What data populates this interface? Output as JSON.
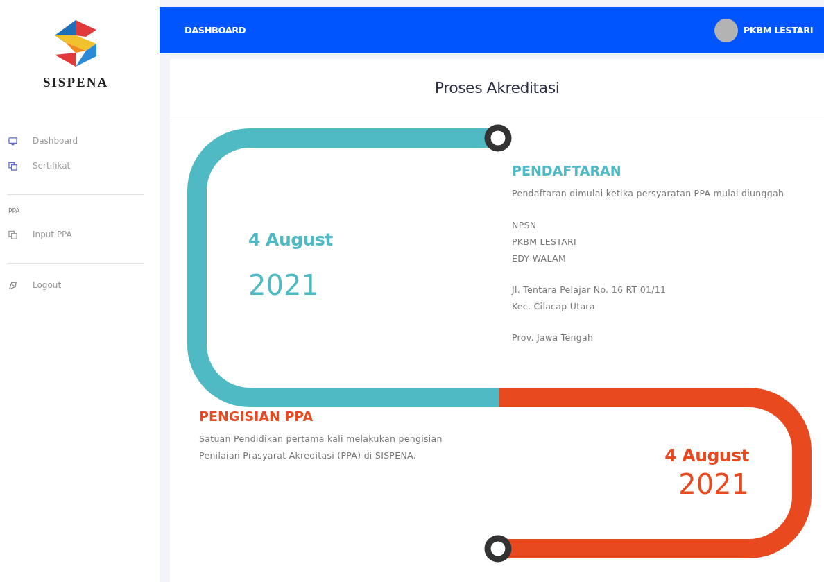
{
  "sidebar": {
    "logo_text": "SISPENA",
    "groups": [
      {
        "items": [
          {
            "label": "Dashboard",
            "kind": "monitor"
          },
          {
            "label": "Sertifikat",
            "kind": "copy"
          }
        ]
      },
      {
        "heading": "PPA",
        "items": [
          {
            "label": "Input PPA",
            "kind": "copygrey"
          }
        ]
      },
      {
        "items": [
          {
            "label": "Logout",
            "kind": "logout"
          }
        ]
      }
    ]
  },
  "topbar": {
    "title": "DASHBOARD",
    "user": "PKBM LESTARI"
  },
  "page_title": "Proses Akreditasi",
  "steps": [
    {
      "kind": "left",
      "color": "#4fb9c4",
      "date": "4 August",
      "year": "2021",
      "title": "PENDAFTARAN",
      "description": "Pendaftaran dimulai ketika persyaratan PPA mulai diunggah",
      "details": [
        [
          "NPSN",
          "PKBM LESTARI",
          "EDY WALAM"
        ],
        [
          "Jl. Tentara Pelajar No. 16 RT 01/11",
          "Kec. Cilacap Utara"
        ],
        [
          "Prov. Jawa Tengah"
        ]
      ]
    },
    {
      "kind": "right",
      "color": "#e8491f",
      "date": "4 August",
      "year": "2021",
      "title": "PENGISIAN PPA",
      "description": "Satuan Pendidikan pertama kali melakukan pengisian Penilaian Prasyarat Akreditasi (PPA) di SISPENA."
    }
  ]
}
